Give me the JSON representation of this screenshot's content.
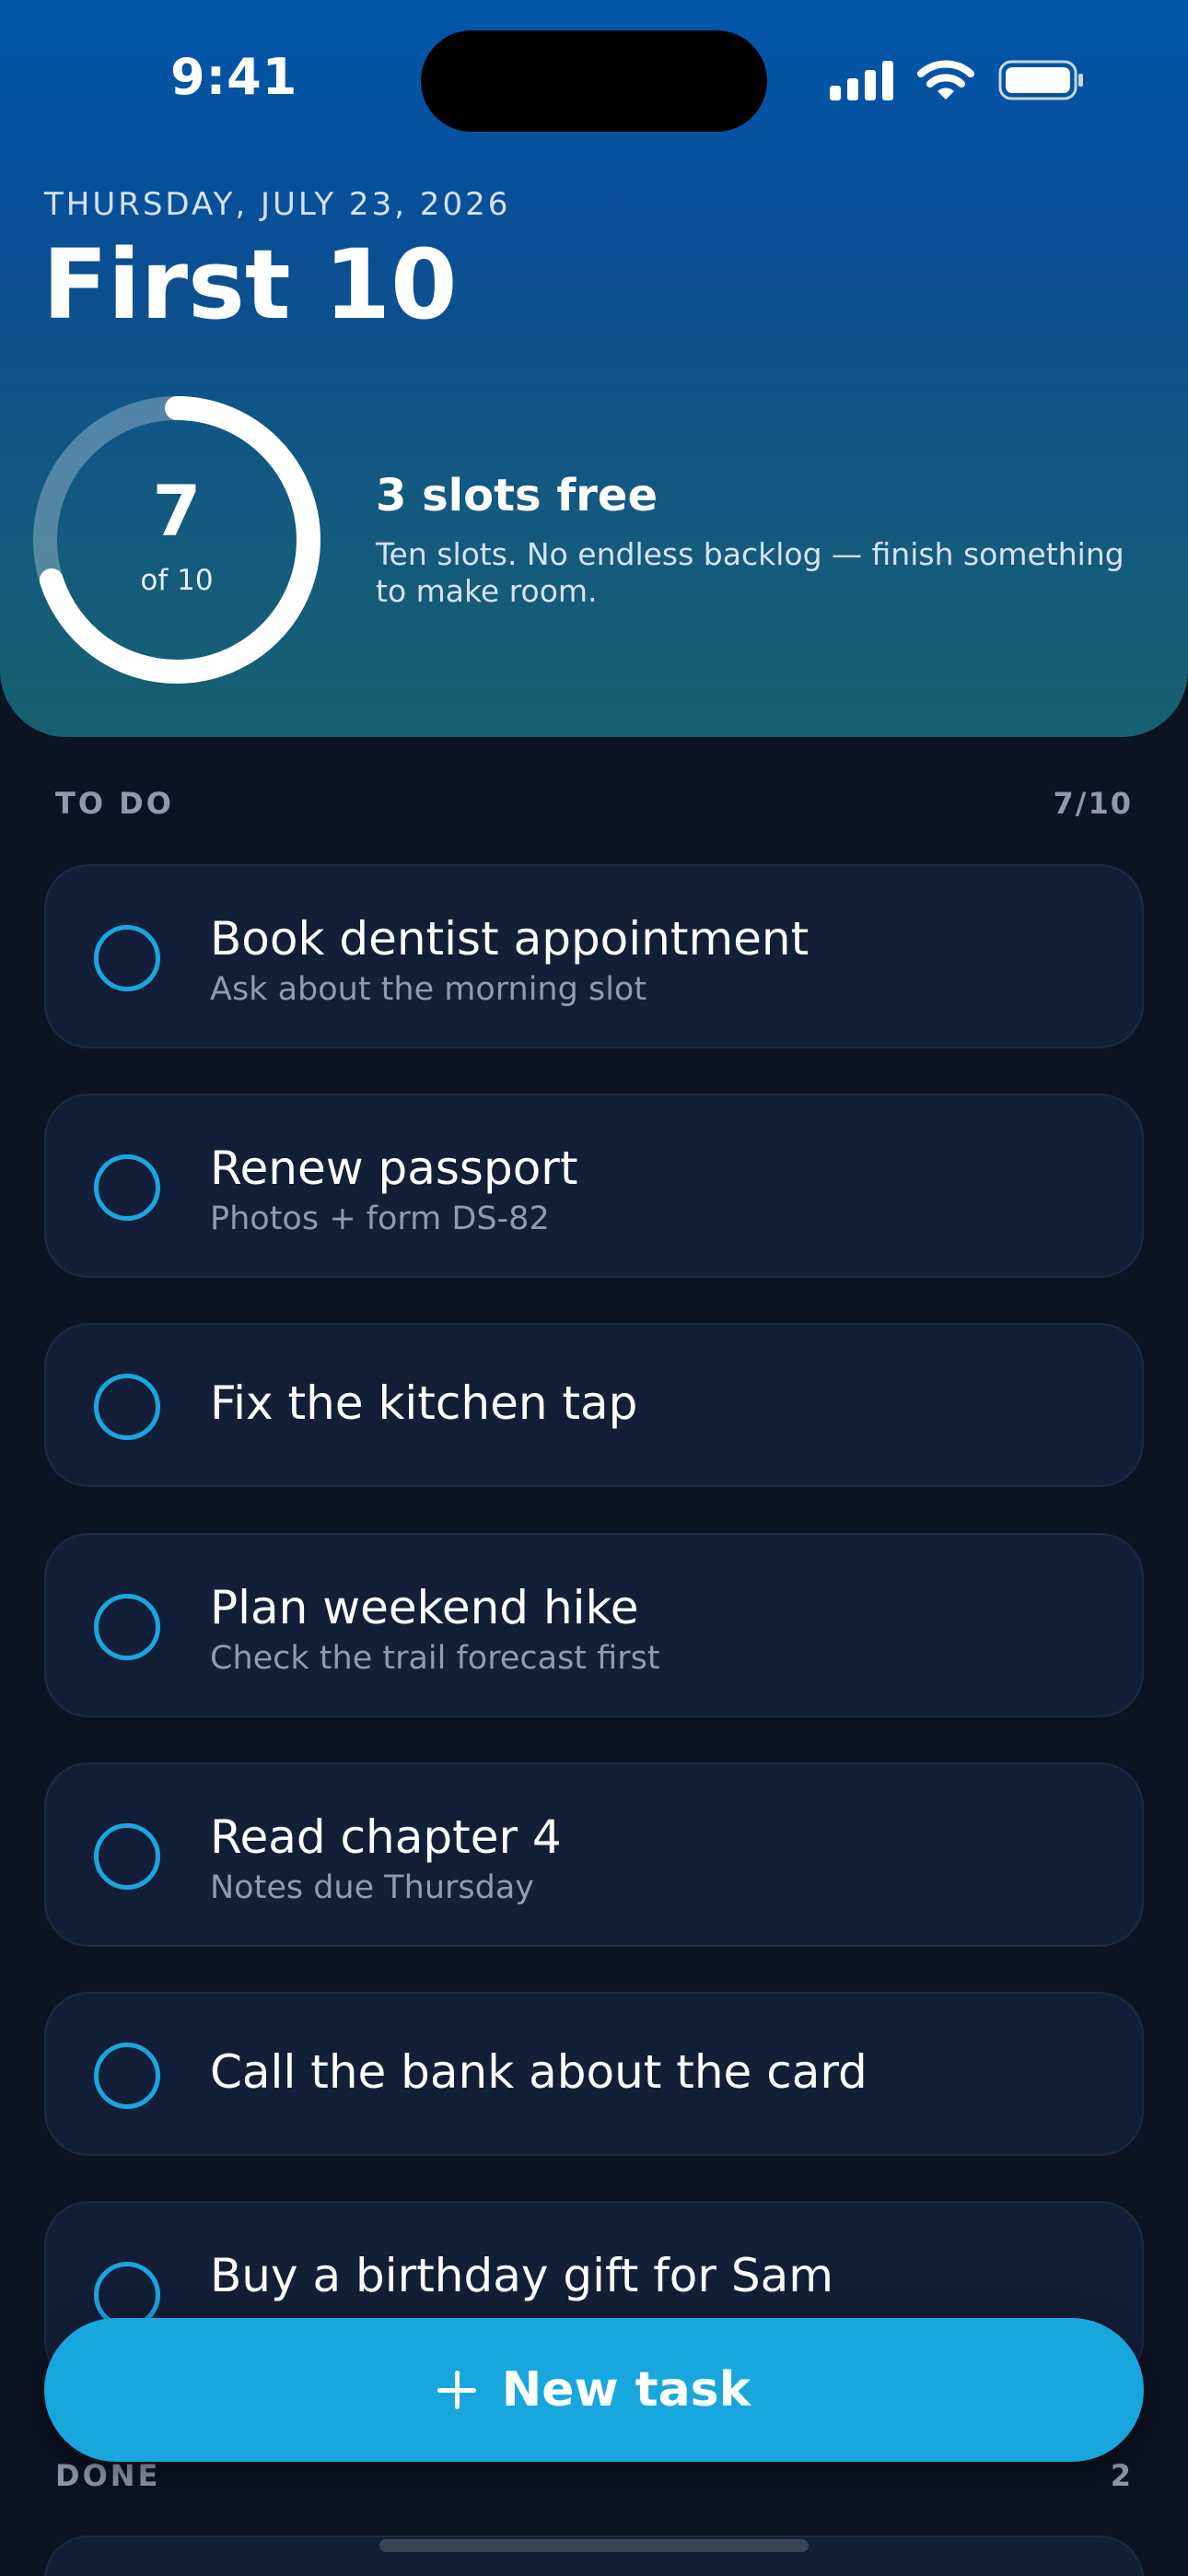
{
  "status_bar": {
    "time": "9:41"
  },
  "header": {
    "date": "THURSDAY, JULY 23, 2026",
    "title": "First 10"
  },
  "progress": {
    "count": "7",
    "of_label": "of 10",
    "fraction": 0.7
  },
  "slots": {
    "title": "3 slots free",
    "description": "Ten slots. No endless backlog — finish something to make room."
  },
  "todo": {
    "label": "TO DO",
    "count": "7/10",
    "tasks": [
      {
        "title": "Book dentist appointment",
        "note": "Ask about the morning slot"
      },
      {
        "title": "Renew passport",
        "note": "Photos + form DS-82"
      },
      {
        "title": "Fix the kitchen tap",
        "note": ""
      },
      {
        "title": "Plan weekend hike",
        "note": "Check the trail forecast first"
      },
      {
        "title": "Read chapter 4",
        "note": "Notes due Thursday"
      },
      {
        "title": "Call the bank about the card",
        "note": ""
      },
      {
        "title": "Buy a birthday gift for Sam",
        "note": ""
      }
    ]
  },
  "done": {
    "label": "DONE",
    "count": "2"
  },
  "new_task_button": {
    "label": "New task"
  },
  "colors": {
    "accent": "#17a7dd",
    "background": "#0c1322",
    "card": "#131f38",
    "header_top": "#0156ab",
    "header_bottom": "#176070"
  }
}
